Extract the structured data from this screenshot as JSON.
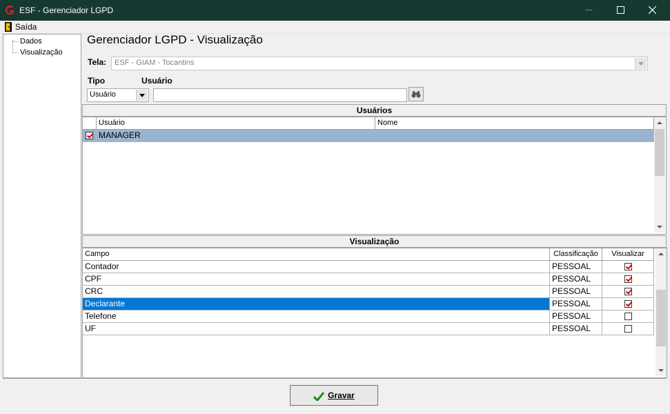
{
  "window": {
    "title": "ESF - Gerenciador LGPD",
    "minimize_icon": "minimize-icon",
    "maximize_icon": "maximize-icon",
    "close_icon": "close-icon"
  },
  "menu": {
    "items": [
      {
        "label": "Saída",
        "icon": "exit-door-icon"
      }
    ]
  },
  "tree": {
    "items": [
      {
        "label": "Dados"
      },
      {
        "label": "Visualização"
      }
    ]
  },
  "main": {
    "title": "Gerenciador LGPD - Visualização",
    "tela_label": "Tela:",
    "tela_value": "ESF - GIAM - Tocantins",
    "tipo_label": "Tipo",
    "usuario_label": "Usuário",
    "tipo_value": "Usuário",
    "usuario_value": "",
    "search_icon": "binoculars-icon"
  },
  "usuarios": {
    "section_title": "Usuários",
    "columns": [
      "Usuário",
      "Nome"
    ],
    "rows": [
      {
        "checked": true,
        "usuario": "MANAGER",
        "nome": ""
      }
    ]
  },
  "visualizacao": {
    "section_title": "Visualização",
    "columns": [
      "Campo",
      "Classificação",
      "Visualizar"
    ],
    "rows": [
      {
        "campo": "Contador",
        "classificacao": "PESSOAL",
        "visualizar": true
      },
      {
        "campo": "CPF",
        "classificacao": "PESSOAL",
        "visualizar": true
      },
      {
        "campo": "CRC",
        "classificacao": "PESSOAL",
        "visualizar": true
      },
      {
        "campo": "Declarante",
        "classificacao": "PESSOAL",
        "visualizar": true,
        "selected": true
      },
      {
        "campo": "Telefone",
        "classificacao": "PESSOAL",
        "visualizar": false
      },
      {
        "campo": "UF",
        "classificacao": "PESSOAL",
        "visualizar": false
      }
    ]
  },
  "footer": {
    "save_label": "Gravar",
    "save_icon": "check-icon"
  },
  "colors": {
    "titlebar": "#163a31",
    "selected_row": "#0078d7",
    "user_row": "#99b4d1",
    "check_red": "#d00000"
  }
}
